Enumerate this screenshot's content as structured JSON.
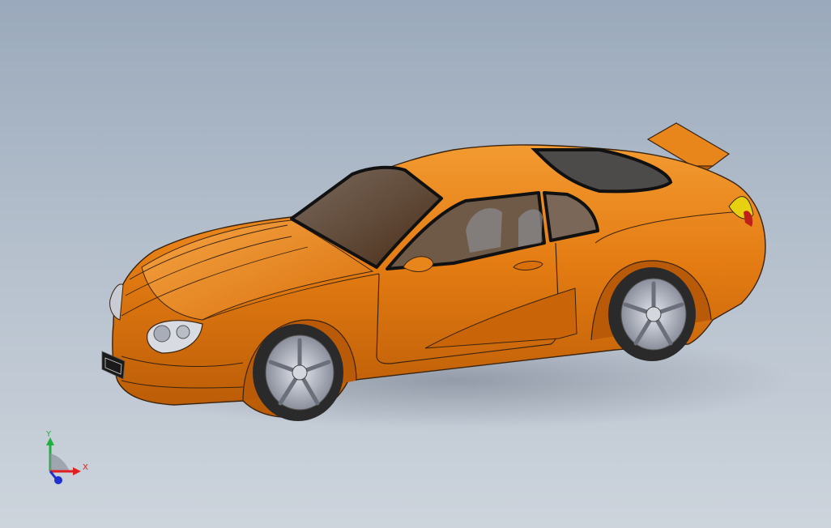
{
  "viewport": {
    "background_top": "#9aa9bb",
    "background_bottom": "#cdd4dc"
  },
  "model": {
    "name": "sports-car",
    "body_color": "#e07a10",
    "glass_color": "#5b3a20",
    "tire_color": "#2a2a2a",
    "rim_color": "#b8bcc4"
  },
  "triad": {
    "x_label": "X",
    "y_label": "Y",
    "x_color": "#e02020",
    "y_color": "#20b040",
    "z_color": "#2030d0"
  }
}
